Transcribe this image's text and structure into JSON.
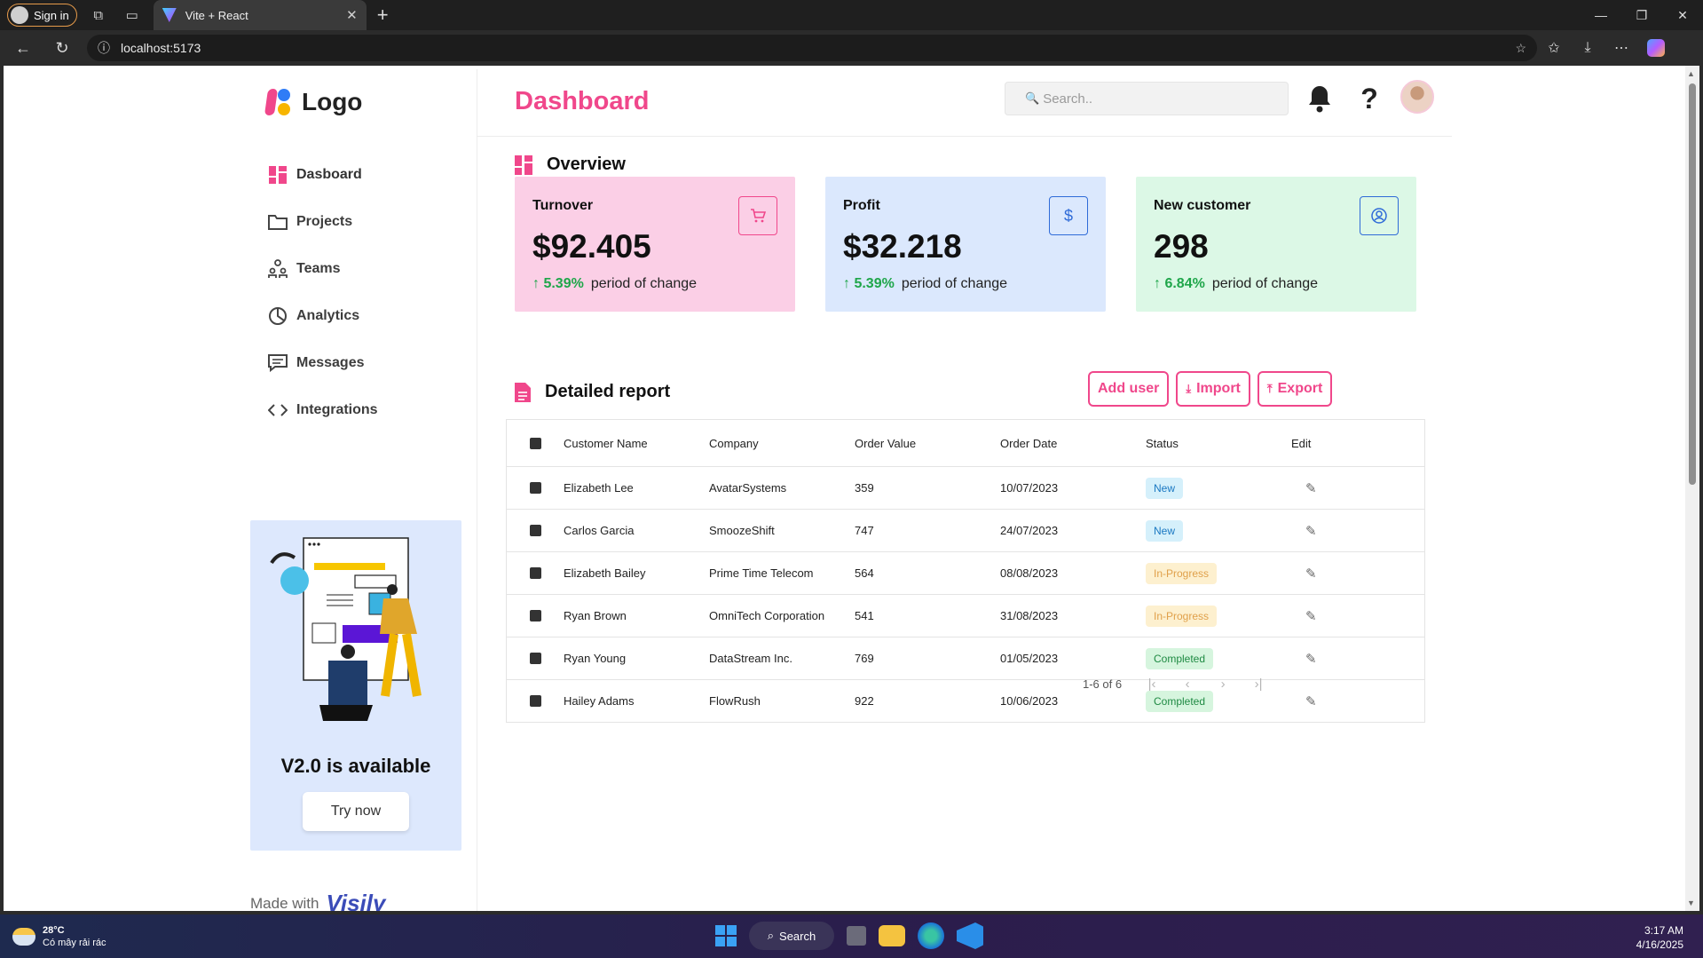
{
  "browser": {
    "sign_in": "Sign in",
    "tab_title": "Vite + React",
    "url": "localhost:5173"
  },
  "sidebar": {
    "logo_text": "Logo",
    "items": [
      {
        "label": "Dasboard",
        "icon": "grid-icon"
      },
      {
        "label": "Projects",
        "icon": "folder-icon"
      },
      {
        "label": "Teams",
        "icon": "team-icon"
      },
      {
        "label": "Analytics",
        "icon": "pie-chart-icon"
      },
      {
        "label": "Messages",
        "icon": "message-icon"
      },
      {
        "label": "Integrations",
        "icon": "code-icon"
      }
    ],
    "promo_title": "V2.0 is available",
    "promo_button": "Try now",
    "made_with": "Made with",
    "brand": "Visily"
  },
  "header": {
    "title": "Dashboard",
    "search_placeholder": "Search.."
  },
  "overview": {
    "title": "Overview",
    "cards": [
      {
        "label": "Turnover",
        "value": "$92.405",
        "change": "5.39%",
        "change_text": "period of change",
        "icon": "cart-icon"
      },
      {
        "label": "Profit",
        "value": "$32.218",
        "change": "5.39%",
        "change_text": "period of change",
        "icon": "dollar-icon"
      },
      {
        "label": "New customer",
        "value": "298",
        "change": "6.84%",
        "change_text": "period of change",
        "icon": "user-circle-icon"
      }
    ]
  },
  "report": {
    "title": "Detailed report",
    "actions": {
      "add_user": "Add user",
      "import": "Import",
      "export": "Export"
    },
    "columns": [
      "Customer Name",
      "Company",
      "Order Value",
      "Order Date",
      "Status",
      "Edit"
    ],
    "rows": [
      {
        "name": "Elizabeth Lee",
        "company": "AvatarSystems",
        "value": "359",
        "date": "10/07/2023",
        "status": "New"
      },
      {
        "name": "Carlos Garcia",
        "company": "SmoozeShift",
        "value": "747",
        "date": "24/07/2023",
        "status": "New"
      },
      {
        "name": "Elizabeth Bailey",
        "company": "Prime Time Telecom",
        "value": "564",
        "date": "08/08/2023",
        "status": "In-Progress"
      },
      {
        "name": "Ryan Brown",
        "company": "OmniTech Corporation",
        "value": "541",
        "date": "31/08/2023",
        "status": "In-Progress"
      },
      {
        "name": "Ryan Young",
        "company": "DataStream Inc.",
        "value": "769",
        "date": "01/05/2023",
        "status": "Completed"
      },
      {
        "name": "Hailey Adams",
        "company": "FlowRush",
        "value": "922",
        "date": "10/06/2023",
        "status": "Completed"
      }
    ],
    "pagination": "1-6 of 6"
  },
  "taskbar": {
    "temp": "28°C",
    "weather": "Có mây rải rác",
    "search": "Search",
    "time": "3:17 AM",
    "date": "4/16/2025"
  },
  "colors": {
    "accent": "#f0478b",
    "turnover_bg": "#fbcfe6",
    "profit_bg": "#dbe8fd",
    "customer_bg": "#dcf8e6",
    "positive": "#1fa64a"
  }
}
